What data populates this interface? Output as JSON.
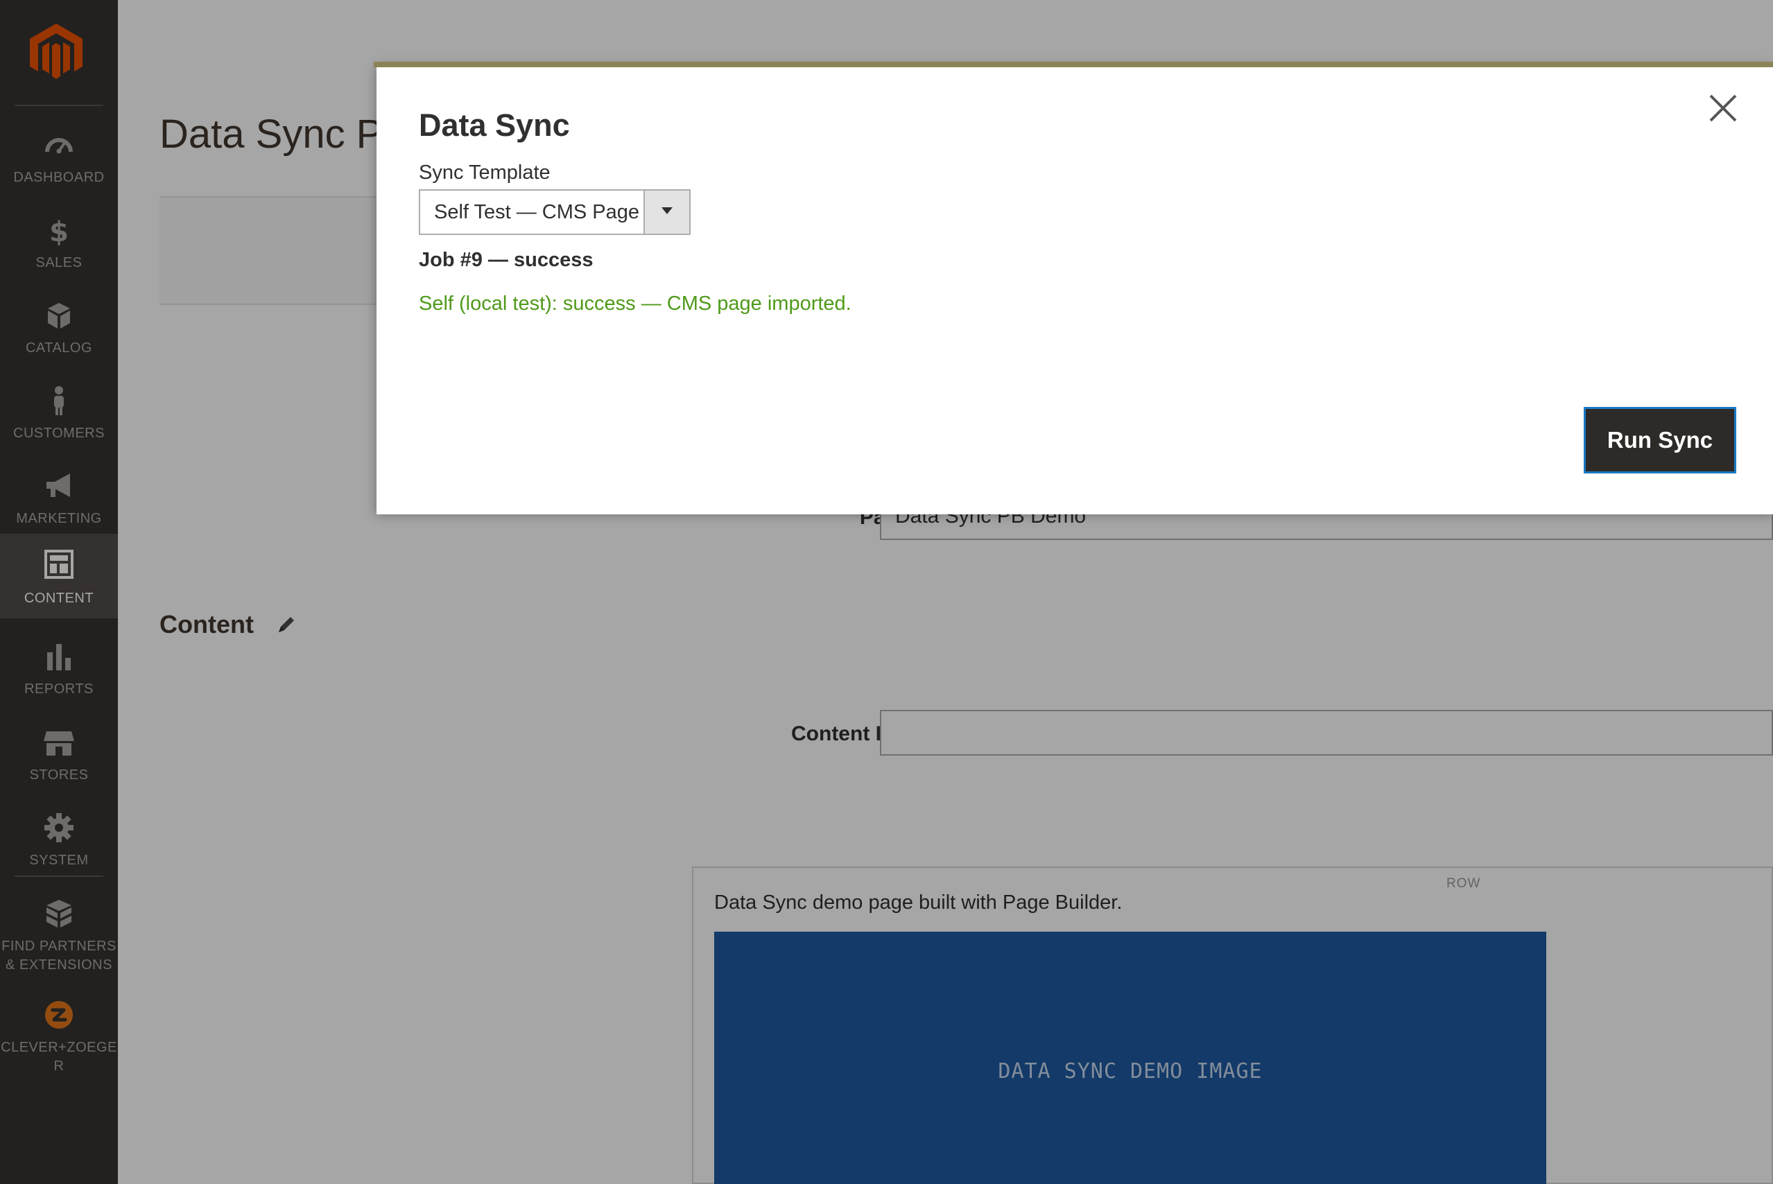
{
  "app": {
    "logo_icon": "magento-logo-icon",
    "brand_color": "#eb5202"
  },
  "sidebar": {
    "items": [
      {
        "label": "DASHBOARD",
        "icon": "dashboard-icon"
      },
      {
        "label": "SALES",
        "icon": "dollar-icon"
      },
      {
        "label": "CATALOG",
        "icon": "box-icon"
      },
      {
        "label": "CUSTOMERS",
        "icon": "person-icon"
      },
      {
        "label": "MARKETING",
        "icon": "megaphone-icon"
      },
      {
        "label": "CONTENT",
        "icon": "layout-icon",
        "active": true
      },
      {
        "label": "REPORTS",
        "icon": "bar-chart-icon"
      },
      {
        "label": "STORES",
        "icon": "storefront-icon"
      },
      {
        "label": "SYSTEM",
        "icon": "gear-icon"
      },
      {
        "label": "FIND PARTNERS\n& EXTENSIONS",
        "icon": "cube-stack-icon"
      },
      {
        "label": "CLEVER+ZOEGE\nR",
        "icon": "clever-zoeger-logo-icon"
      }
    ]
  },
  "page": {
    "title": "Data Sync PB Demo",
    "page_title_label": "Page Title",
    "page_title_value": "Data Sync PB Demo",
    "content_section_title": "Content",
    "content_heading_label": "Content Heading",
    "content_heading_value": "",
    "page_builder": {
      "row_label": "ROW",
      "text": "Data Sync demo page built with Page Builder.",
      "image_text": "DATA SYNC DEMO IMAGE"
    }
  },
  "modal": {
    "title": "Data Sync",
    "close_icon": "close-icon",
    "select_label": "Sync Template",
    "select_value": "Self Test — CMS Page",
    "job_status": "Job #9 — success",
    "result_message": "Self (local test): success — CMS page imported.",
    "result_color": "#4f9a19",
    "run_button_label": "Run Sync"
  }
}
